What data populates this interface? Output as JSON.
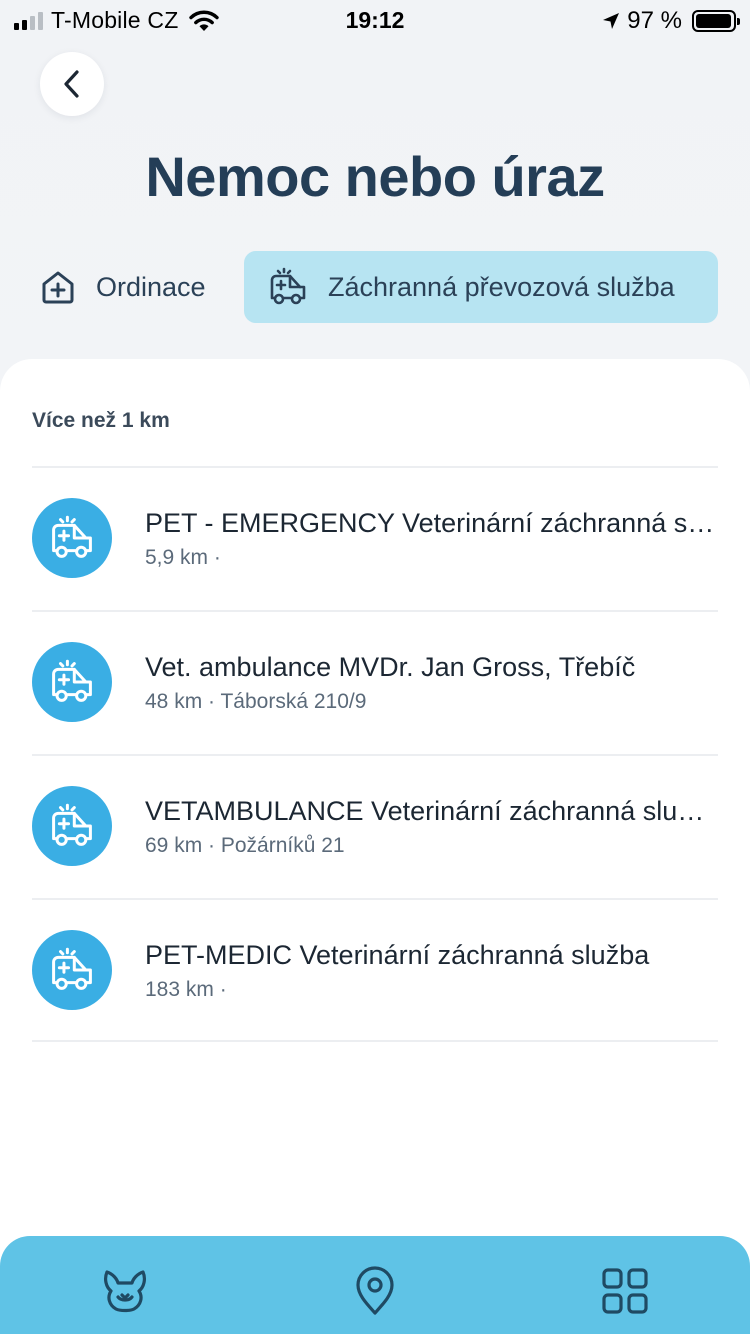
{
  "status_bar": {
    "carrier": "T-Mobile CZ",
    "time": "19:12",
    "battery_text": "97 %",
    "battery_level": 0.97
  },
  "header": {
    "title": "Nemoc nebo úraz"
  },
  "tabs": [
    {
      "label": "Ordinace",
      "icon": "clinic-icon",
      "active": false
    },
    {
      "label": "Záchranná převozová služba",
      "icon": "ambulance-icon",
      "active": true
    }
  ],
  "section": {
    "title": "Více než 1 km"
  },
  "items": [
    {
      "name": "PET - EMERGENCY Veterinární záchranná služba",
      "meta": "5,9 km ·",
      "icon": "ambulance-icon"
    },
    {
      "name": "Vet. ambulance MVDr. Jan Gross, Třebíč",
      "meta": "48 km · Táborská 210/9",
      "icon": "ambulance-icon"
    },
    {
      "name": "VETAMBULANCE Veterinární záchranná služba",
      "meta": "69 km · Požárníků 21",
      "icon": "ambulance-icon"
    },
    {
      "name": "PET-MEDIC Veterinární záchranná služba",
      "meta": "183 km ·",
      "icon": "ambulance-icon"
    }
  ],
  "bottom_nav": [
    {
      "icon": "pet-icon"
    },
    {
      "icon": "map-pin-icon"
    },
    {
      "icon": "grid-icon"
    }
  ],
  "colors": {
    "title": "#243e57",
    "active_tab_bg": "#b7e4f2",
    "item_icon_bg": "#3aaee4",
    "tab_bar_bg": "#5fc3e6",
    "nav_icon": "#1f4a63"
  }
}
